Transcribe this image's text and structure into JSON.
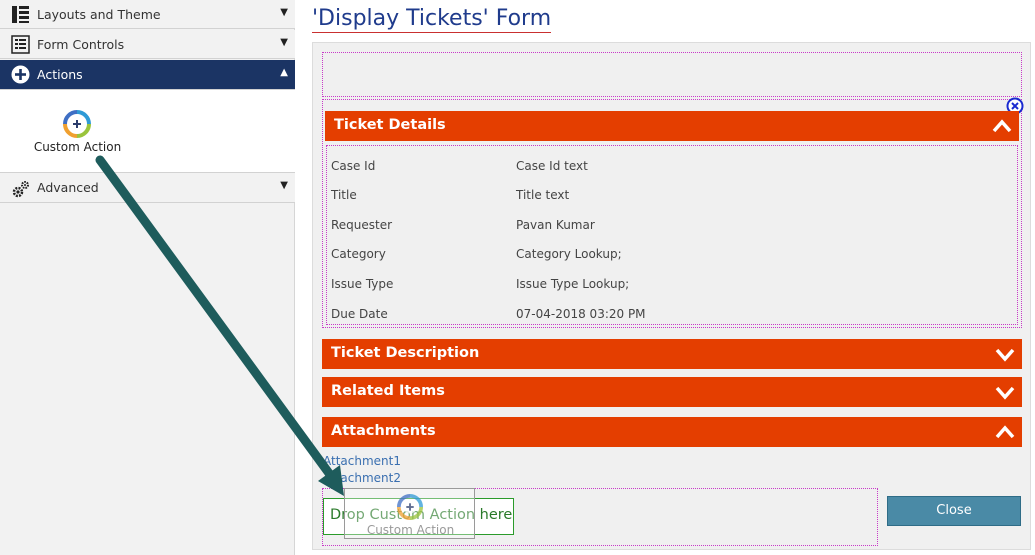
{
  "toolbox": {
    "sections": [
      {
        "label": "Layouts and Theme",
        "icon": "layout-list-icon",
        "expanded": false
      },
      {
        "label": "Form Controls",
        "icon": "form-controls-icon",
        "expanded": false
      },
      {
        "label": "Actions",
        "icon": "plus-circle-icon",
        "expanded": true
      },
      {
        "label": "Advanced",
        "icon": "gears-icon",
        "expanded": false
      }
    ],
    "actions_items": [
      {
        "label": "Custom Action",
        "icon": "custom-action-icon"
      }
    ]
  },
  "form": {
    "title": "'Display Tickets' Form",
    "sections": [
      {
        "title": "Ticket Details",
        "expanded": true
      },
      {
        "title": "Ticket Description",
        "expanded": false
      },
      {
        "title": "Related Items",
        "expanded": false
      },
      {
        "title": "Attachments",
        "expanded": true
      }
    ],
    "fields": [
      {
        "label": "Case Id",
        "value": "Case Id text"
      },
      {
        "label": "Title",
        "value": "Title text"
      },
      {
        "label": "Requester",
        "value": "Pavan Kumar"
      },
      {
        "label": "Category",
        "value": "Category Lookup;"
      },
      {
        "label": "Issue Type",
        "value": "Issue Type Lookup;"
      },
      {
        "label": "Due Date",
        "value": "07-04-2018 03:20 PM"
      }
    ],
    "attachments": [
      "Attachment1",
      "Attachment2"
    ],
    "drop_hint": "Drop Custom Action here",
    "drag_ghost_label": "Custom Action",
    "close_label": "Close"
  },
  "colors": {
    "section_header": "#e43e00",
    "toolbox_active": "#1b3464",
    "title_text": "#1f3b8c",
    "close_button": "#4a8aa6",
    "drop_hint_border": "#2b9b2b",
    "drag_arrow": "#1e5c5c"
  }
}
